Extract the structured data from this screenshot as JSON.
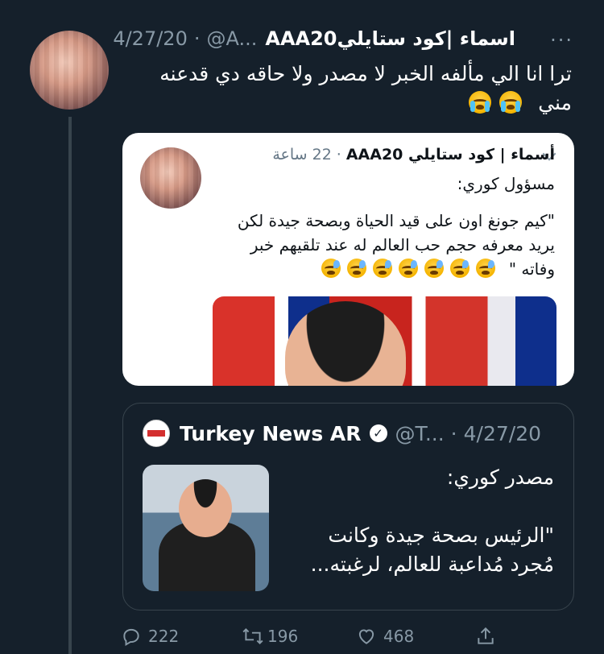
{
  "tweet": {
    "author_name": "اسماء |كود ستايليAAA20",
    "handle": "@A...",
    "date": "4/27/20",
    "text_line1": "ترا انا الي مألفه الخبر لا مصدر ولا حاقه دي قدعنه",
    "text_line2": "مني",
    "more_icon": "more-horizontal-icon"
  },
  "quoted_screenshot": {
    "author_name": "أسماء | كود ستايلي AAA20",
    "time": "22 ساعة",
    "text_line1": "مسؤول كوري:",
    "text_line2": "\"كيم جونغ اون على قيد الحياة وبصحة جيدة لكن",
    "text_line3": "يريد معرفه حجم حب العالم له عند تلقيهم خبر",
    "text_line4": "وفاته \""
  },
  "quote_tweet": {
    "author_name": "Turkey News AR",
    "handle": "@T...",
    "date": "4/27/20",
    "text_line1": "مصدر كوري:",
    "text_line2": "\"الرئيس بصحة جيدة وكانت",
    "text_line3": "مُجرد مُداعبة للعالم، لرغبته..."
  },
  "actions": {
    "replies": "222",
    "retweets": "196",
    "likes": "468"
  },
  "colors": {
    "background": "#15202b",
    "secondary_text": "#8899a6",
    "border": "#38444d"
  }
}
